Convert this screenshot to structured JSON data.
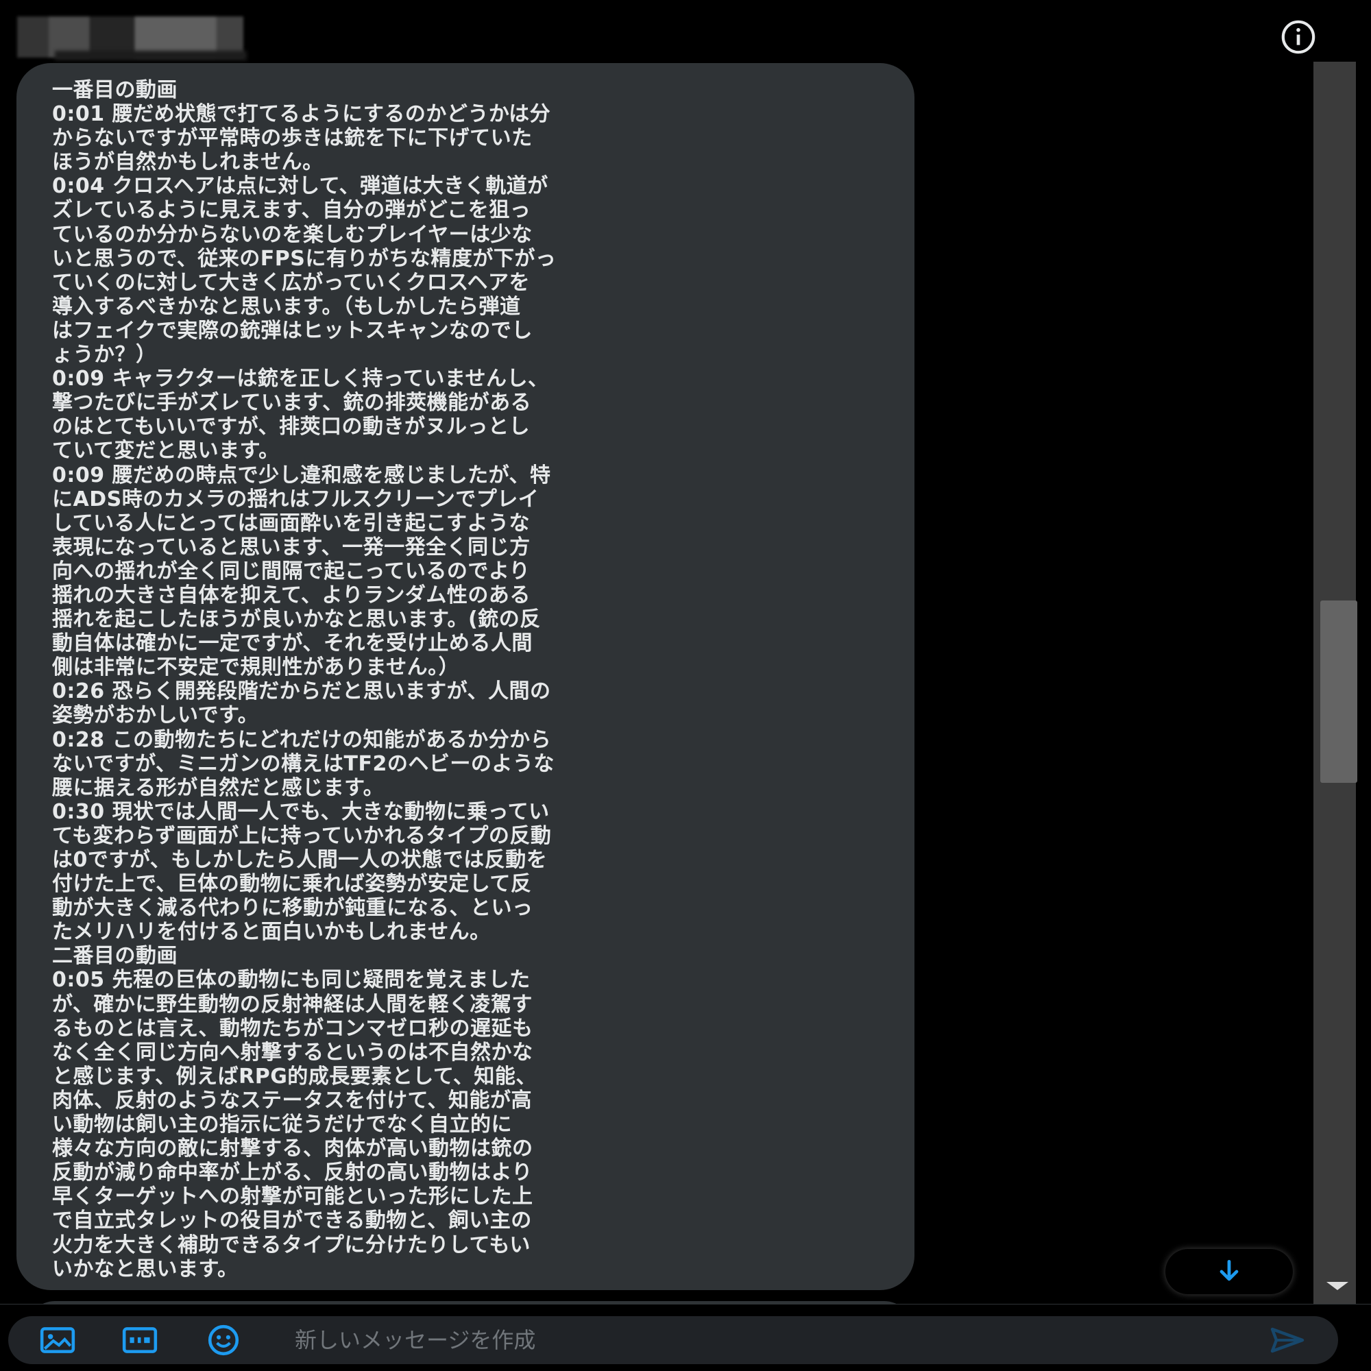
{
  "colors": {
    "background": "#000000",
    "bubble": "#2f3336",
    "text": "#e7e9ea",
    "accent": "#1d9bf0",
    "placeholder": "#71767b"
  },
  "header": {
    "info_icon": "info-circle-icon"
  },
  "message": {
    "lines": [
      "一番目の動画",
      "0:01 腰だめ状態で打てるようにするのかどうかは分",
      "からないですが平常時の歩きは銃を下に下げていた",
      "ほうが自然かもしれません。",
      "0:04 クロスヘアは点に対して、弾道は大きく軌道が",
      "ズレているように見えます、自分の弾がどこを狙っ",
      "ているのか分からないのを楽しむプレイヤーは少な",
      "いと思うので、従来のFPSに有りがちな精度が下がっ",
      "ていくのに対して大きく広がっていくクロスヘアを",
      "導入するべきかなと思います。（もしかしたら弾道",
      "はフェイクで実際の銃弾はヒットスキャンなのでし",
      "ょうか？）",
      "0:09 キャラクターは銃を正しく持っていませんし、",
      "撃つたびに手がズレています、銃の排莢機能がある",
      "のはとてもいいですが、排莢口の動きがヌルっとし",
      "ていて変だと思います。",
      "0:09 腰だめの時点で少し違和感を感じましたが、特",
      "にADS時のカメラの揺れはフルスクリーンでプレイ",
      "している人にとっては画面酔いを引き起こすような",
      "表現になっていると思います、一発一発全く同じ方",
      "向への揺れが全く同じ間隔で起こっているのでより",
      "揺れの大きさ自体を抑えて、よりランダム性のある",
      "揺れを起こしたほうが良いかなと思います。(銃の反",
      "動自体は確かに一定ですが、それを受け止める人間",
      "側は非常に不安定で規則性がありません。）",
      "0:26 恐らく開発段階だからだと思いますが、人間の",
      "姿勢がおかしいです。",
      "0:28 この動物たちにどれだけの知能があるか分から",
      "ないですが、ミニガンの構えはTF2のヘビーのような",
      "腰に据える形が自然だと感じます。",
      "0:30 現状では人間一人でも、大きな動物に乗ってい",
      "ても変わらず画面が上に持っていかれるタイプの反動",
      "は0ですが、もしかしたら人間一人の状態では反動を",
      "付けた上で、巨体の動物に乗れば姿勢が安定して反",
      "動が大きく減る代わりに移動が鈍重になる、といっ",
      "たメリハリを付けると面白いかもしれません。",
      "二番目の動画",
      "0:05 先程の巨体の動物にも同じ疑問を覚えました",
      "が、確かに野生動物の反射神経は人間を軽く凌駕す",
      "るものとは言え、動物たちがコンマゼロ秒の遅延も",
      "なく全く同じ方向へ射撃するというのは不自然かな",
      "と感じます、例えばRPG的成長要素として、知能、",
      "肉体、反射のようなステータスを付けて、知能が高",
      "い動物は飼い主の指示に従うだけでなく自立的に",
      "様々な方向の敵に射撃する、肉体が高い動物は銃の",
      "反動が減り命中率が上がる、反射の高い動物はより",
      "早くターゲットへの射撃が可能といった形にした上",
      "で自立式タレットの役目ができる動物と、飼い主の",
      "火力を大きく補助できるタイプに分けたりしてもい",
      "いかなと思います。"
    ]
  },
  "scroll": {
    "jump_icon": "arrow-down-icon"
  },
  "composer": {
    "placeholder": "新しいメッセージを作成",
    "value": "",
    "tools": [
      {
        "name": "image-button",
        "icon": "image-icon"
      },
      {
        "name": "gif-button",
        "icon": "gif-icon"
      },
      {
        "name": "emoji-button",
        "icon": "emoji-icon"
      }
    ],
    "send_icon": "send-icon"
  }
}
